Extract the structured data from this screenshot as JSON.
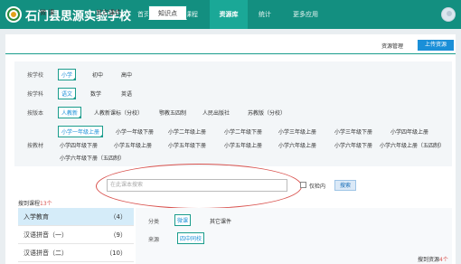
{
  "nav": {
    "school": "石门县思源实验学校",
    "items": [
      "首页",
      "我的课程",
      "资源库",
      "统计",
      "更多应用"
    ],
    "active_index": 2
  },
  "tabs": {
    "items": [
      "微 课",
      "其它课件",
      "知识点"
    ],
    "active_index": 2,
    "resource_manage": "资源管理",
    "upload": "上传资源"
  },
  "filters": {
    "school_label": "按学校",
    "school_options": [
      "小学",
      "初中",
      "高中"
    ],
    "subject_label": "按学科",
    "subject_options": [
      "语文",
      "数学",
      "英语"
    ],
    "edition_label": "按版本",
    "edition_options": [
      "人教新",
      "人教新课标（分校）",
      "鄂教五四制",
      "人民出版社",
      "苏教版（分校）"
    ],
    "material_label": "按教材",
    "material_options": [
      "小学一年级上册",
      "小学一年级下册",
      "小学二年级上册",
      "小学二年级下册",
      "小学三年级上册",
      "小学三年级下册",
      "小学四年级上册",
      "小学四年级下册",
      "小学五年级上册",
      "小学五年级下册",
      "小学五年级上册",
      "小学六年级上册",
      "小学六年级下册",
      "小学六年级上册（五四制）",
      "小学六年级下册（五四制）"
    ]
  },
  "search": {
    "placeholder": "在此课本搜索",
    "checkbox_label": "仅检内",
    "button": "搜索"
  },
  "catalog": {
    "count_prefix": "搜到课程",
    "count_value": "13个",
    "items": [
      {
        "label": "入学教育",
        "count": "（4）"
      },
      {
        "label": "汉语拼音（一）",
        "count": "（9）"
      },
      {
        "label": "汉语拼音（二）",
        "count": "（10）"
      }
    ]
  },
  "detail": {
    "type_label": "分类",
    "type_selected": "微课",
    "type_other": "其它课件",
    "source_label": "来源",
    "source_selected": "四中同校",
    "result_prefix": "搜到资源",
    "result_value": "4个"
  },
  "colors": {
    "nav": "#138f80",
    "accent": "#1a9c8c",
    "link": "#1a8fd8",
    "highlight": "#d9534f"
  }
}
